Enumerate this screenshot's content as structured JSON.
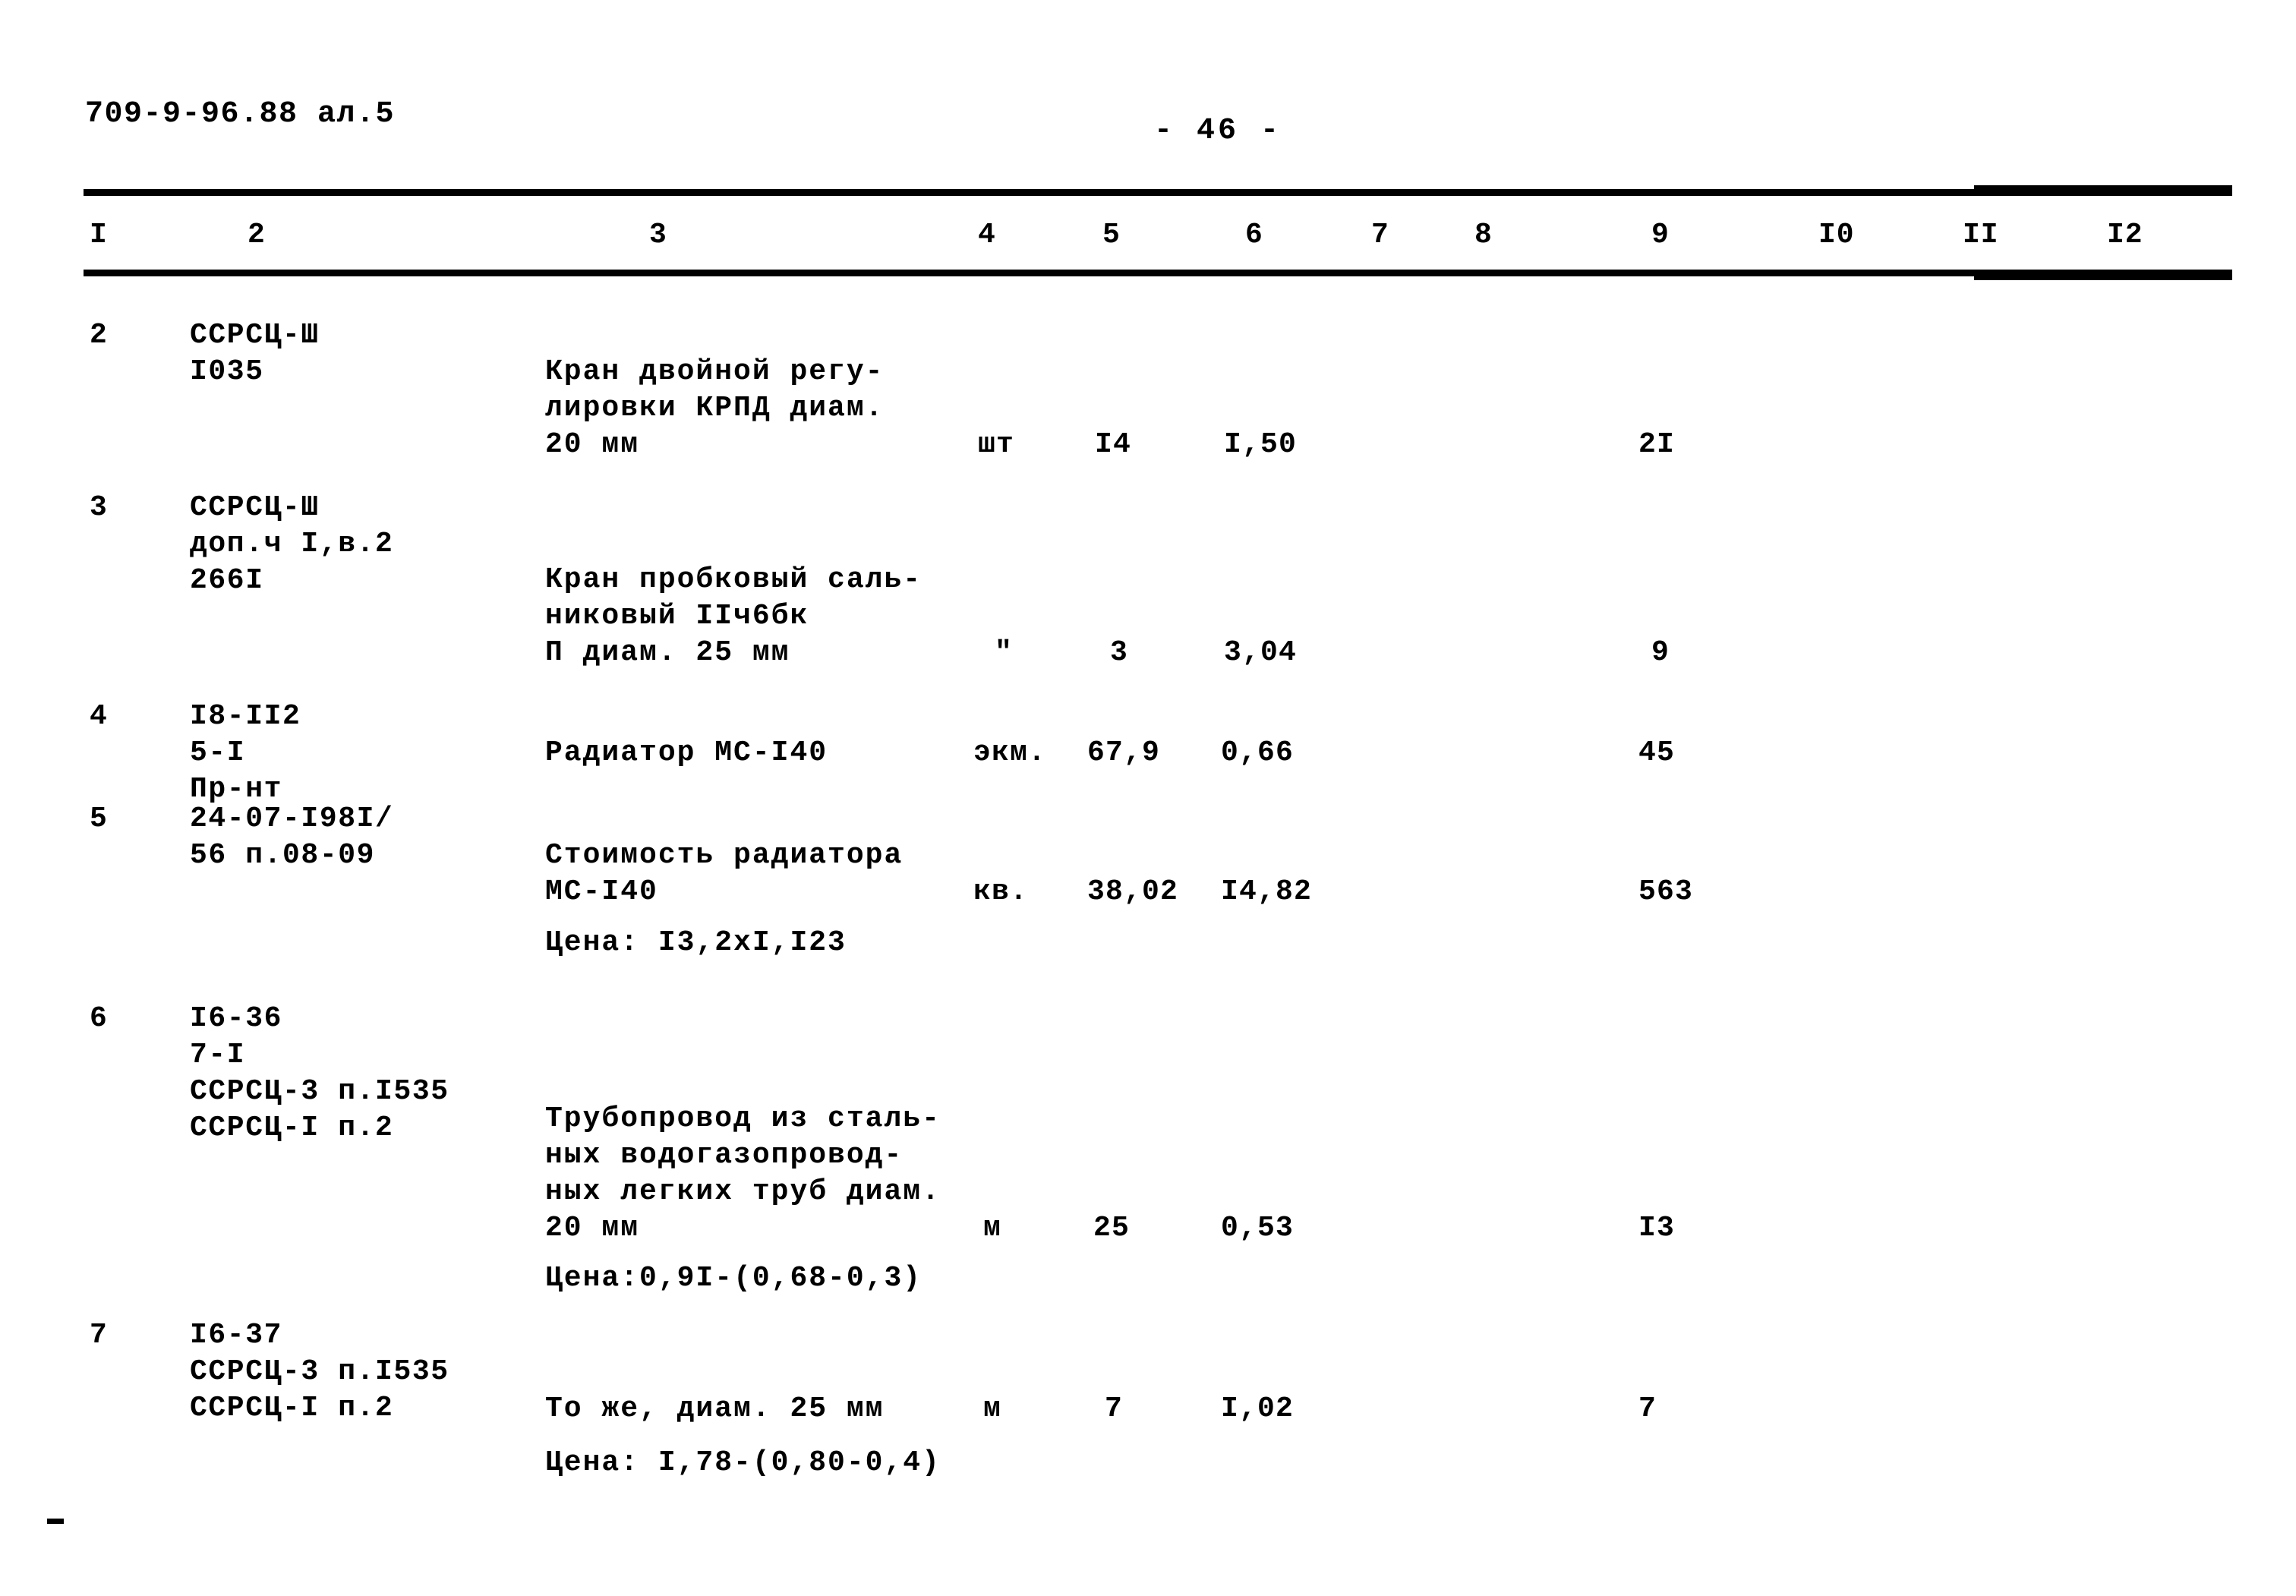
{
  "header": {
    "doc_code": "709-9-96.88 ал.5",
    "page_label": "- 46 -"
  },
  "table": {
    "column_headers": [
      "I",
      "2",
      "3",
      "4",
      "5",
      "6",
      "7",
      "8",
      "9",
      "I0",
      "II",
      "I2"
    ],
    "rows": [
      {
        "no": "2",
        "code": "ССРСЦ-Ш\nI035",
        "description": "Кран двойной регу-\nлировки КРПД диам.\n20 мм",
        "unit": "шт",
        "qty": "I4",
        "price": "I,50",
        "col7": "",
        "col8": "",
        "total": "2I",
        "col10": "",
        "col11": "",
        "col12": "",
        "note": ""
      },
      {
        "no": "3",
        "code": "ССРСЦ-Ш\nдоп.ч I,в.2\n266I",
        "description": "Кран пробковый саль-\nниковый IIч6бк\nП диам. 25 мм",
        "unit": "\"",
        "qty": "3",
        "price": "3,04",
        "col7": "",
        "col8": "",
        "total": "9",
        "col10": "",
        "col11": "",
        "col12": "",
        "note": ""
      },
      {
        "no": "4",
        "code": "I8-II2\n5-I\nПр-нт",
        "description": "Радиатор МС-I40",
        "unit": "экм.",
        "qty": "67,9",
        "price": "0,66",
        "col7": "",
        "col8": "",
        "total": "45",
        "col10": "",
        "col11": "",
        "col12": "",
        "note": ""
      },
      {
        "no": "5",
        "code": "24-07-I98I/\n56 п.08-09",
        "description": "Стоимость радиатора\nМС-I40",
        "unit": "кв.",
        "qty": "38,02",
        "price": "I4,82",
        "col7": "",
        "col8": "",
        "total": "563",
        "col10": "",
        "col11": "",
        "col12": "",
        "note": "Цена: I3,2xI,I23"
      },
      {
        "no": "6",
        "code": "I6-36\n7-I\nССРСЦ-3 п.I535\nССРСЦ-I п.2",
        "description": "Трубопровод из сталь-\nных водогазопровод-\nных легких труб диам.\n20 мм",
        "unit": "м",
        "qty": "25",
        "price": "0,53",
        "col7": "",
        "col8": "",
        "total": "I3",
        "col10": "",
        "col11": "",
        "col12": "",
        "note": "Цена:0,9I-(0,68-0,3)"
      },
      {
        "no": "7",
        "code": "I6-37\nССРСЦ-3 п.I535\nССРСЦ-I п.2",
        "description": "То же, диам. 25 мм",
        "unit": "м",
        "qty": "7",
        "price": "I,02",
        "col7": "",
        "col8": "",
        "total": "7",
        "col10": "",
        "col11": "",
        "col12": "",
        "note": "Цена: I,78-(0,80-0,4)"
      }
    ]
  }
}
